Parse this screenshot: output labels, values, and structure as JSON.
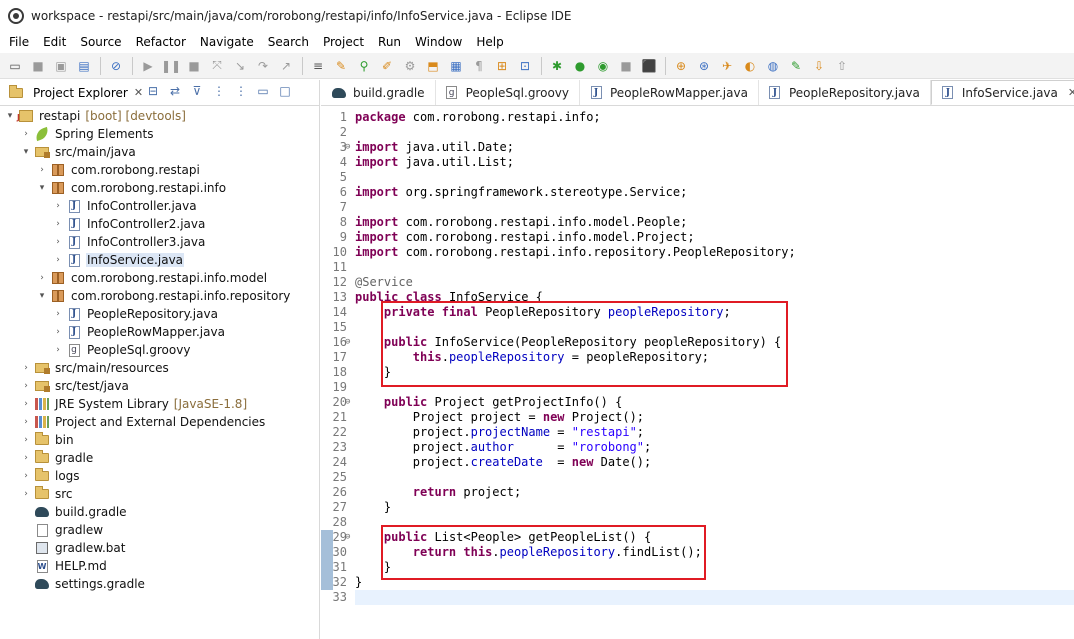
{
  "window": {
    "title": "workspace - restapi/src/main/java/com/rorobong/restapi/info/InfoService.java - Eclipse IDE"
  },
  "menu": [
    "File",
    "Edit",
    "Source",
    "Refactor",
    "Navigate",
    "Search",
    "Project",
    "Run",
    "Window",
    "Help"
  ],
  "explorer": {
    "tab_label": "Project Explorer",
    "tab_close": "✕",
    "tree": [
      {
        "label": "restapi",
        "decor": "[boot] [devtools]",
        "icon": "project-icon",
        "indent": 0,
        "twisty": "▾"
      },
      {
        "label": "Spring Elements",
        "decor": "",
        "icon": "spring-leaf-icon",
        "indent": 1,
        "twisty": "›"
      },
      {
        "label": "src/main/java",
        "decor": "",
        "icon": "source-folder-icon",
        "indent": 1,
        "twisty": "▾"
      },
      {
        "label": "com.rorobong.restapi",
        "decor": "",
        "icon": "package-icon",
        "indent": 2,
        "twisty": "›"
      },
      {
        "label": "com.rorobong.restapi.info",
        "decor": "",
        "icon": "package-icon",
        "indent": 2,
        "twisty": "▾"
      },
      {
        "label": "InfoController.java",
        "decor": "",
        "icon": "java-file-icon",
        "indent": 3,
        "twisty": "›"
      },
      {
        "label": "InfoController2.java",
        "decor": "",
        "icon": "java-file-icon",
        "indent": 3,
        "twisty": "›"
      },
      {
        "label": "InfoController3.java",
        "decor": "",
        "icon": "java-file-icon",
        "indent": 3,
        "twisty": "›"
      },
      {
        "label": "InfoService.java",
        "decor": "",
        "icon": "java-file-icon",
        "indent": 3,
        "twisty": "›",
        "selected": true
      },
      {
        "label": "com.rorobong.restapi.info.model",
        "decor": "",
        "icon": "package-icon",
        "indent": 2,
        "twisty": "›"
      },
      {
        "label": "com.rorobong.restapi.info.repository",
        "decor": "",
        "icon": "package-icon",
        "indent": 2,
        "twisty": "▾"
      },
      {
        "label": "PeopleRepository.java",
        "decor": "",
        "icon": "java-file-icon",
        "indent": 3,
        "twisty": "›"
      },
      {
        "label": "PeopleRowMapper.java",
        "decor": "",
        "icon": "java-file-icon",
        "indent": 3,
        "twisty": "›"
      },
      {
        "label": "PeopleSql.groovy",
        "decor": "",
        "icon": "groovy-file-icon",
        "indent": 3,
        "twisty": "›"
      },
      {
        "label": "src/main/resources",
        "decor": "",
        "icon": "source-folder-icon",
        "indent": 1,
        "twisty": "›"
      },
      {
        "label": "src/test/java",
        "decor": "",
        "icon": "source-folder-icon",
        "indent": 1,
        "twisty": "›"
      },
      {
        "label": "JRE System Library",
        "decor": "[JavaSE-1.8]",
        "icon": "library-icon",
        "indent": 1,
        "twisty": "›"
      },
      {
        "label": "Project and External Dependencies",
        "decor": "",
        "icon": "library-icon",
        "indent": 1,
        "twisty": "›"
      },
      {
        "label": "bin",
        "decor": "",
        "icon": "folder-icon",
        "indent": 1,
        "twisty": "›"
      },
      {
        "label": "gradle",
        "decor": "",
        "icon": "folder-icon",
        "indent": 1,
        "twisty": "›"
      },
      {
        "label": "logs",
        "decor": "",
        "icon": "folder-icon",
        "indent": 1,
        "twisty": "›"
      },
      {
        "label": "src",
        "decor": "",
        "icon": "folder-icon",
        "indent": 1,
        "twisty": "›"
      },
      {
        "label": "build.gradle",
        "decor": "",
        "icon": "gradle-elephant-icon",
        "indent": 1,
        "twisty": ""
      },
      {
        "label": "gradlew",
        "decor": "",
        "icon": "file-icon",
        "indent": 1,
        "twisty": ""
      },
      {
        "label": "gradlew.bat",
        "decor": "",
        "icon": "batch-file-icon",
        "indent": 1,
        "twisty": ""
      },
      {
        "label": "HELP.md",
        "decor": "",
        "icon": "markdown-file-icon",
        "indent": 1,
        "twisty": ""
      },
      {
        "label": "settings.gradle",
        "decor": "",
        "icon": "gradle-elephant-icon",
        "indent": 1,
        "twisty": ""
      }
    ]
  },
  "editor": {
    "tabs": [
      {
        "label": "build.gradle",
        "icon": "gradle-elephant-icon",
        "active": false
      },
      {
        "label": "PeopleSql.groovy",
        "icon": "groovy-file-icon",
        "active": false
      },
      {
        "label": "PeopleRowMapper.java",
        "icon": "java-file-icon",
        "active": false
      },
      {
        "label": "PeopleRepository.java",
        "icon": "java-file-icon",
        "active": false
      },
      {
        "label": "InfoService.java",
        "icon": "java-file-icon",
        "active": true
      }
    ],
    "tab_close": "✕",
    "lines": [
      {
        "n": "1",
        "tokens": [
          [
            "kw",
            "package"
          ],
          [
            "plain",
            " com.rorobong.restapi.info;"
          ]
        ]
      },
      {
        "n": "2",
        "tokens": []
      },
      {
        "n": "3",
        "fold": "⊖",
        "tokens": [
          [
            "kw",
            "import"
          ],
          [
            "plain",
            " java.util.Date;"
          ]
        ]
      },
      {
        "n": "4",
        "tokens": [
          [
            "kw",
            "import"
          ],
          [
            "plain",
            " java.util.List;"
          ]
        ]
      },
      {
        "n": "5",
        "tokens": []
      },
      {
        "n": "6",
        "tokens": [
          [
            "kw",
            "import"
          ],
          [
            "plain",
            " org.springframework.stereotype.Service;"
          ]
        ]
      },
      {
        "n": "7",
        "tokens": []
      },
      {
        "n": "8",
        "tokens": [
          [
            "kw",
            "import"
          ],
          [
            "plain",
            " com.rorobong.restapi.info.model.People;"
          ]
        ]
      },
      {
        "n": "9",
        "tokens": [
          [
            "kw",
            "import"
          ],
          [
            "plain",
            " com.rorobong.restapi.info.model.Project;"
          ]
        ]
      },
      {
        "n": "10",
        "tokens": [
          [
            "kw",
            "import"
          ],
          [
            "plain",
            " com.rorobong.restapi.info.repository.PeopleRepository;"
          ]
        ]
      },
      {
        "n": "11",
        "tokens": []
      },
      {
        "n": "12",
        "tokens": [
          [
            "ann",
            "@Service"
          ]
        ]
      },
      {
        "n": "13",
        "tokens": [
          [
            "kw",
            "public"
          ],
          [
            "plain",
            " "
          ],
          [
            "kw",
            "class"
          ],
          [
            "plain",
            " InfoService {"
          ]
        ]
      },
      {
        "n": "14",
        "tokens": [
          [
            "plain",
            "    "
          ],
          [
            "kw",
            "private"
          ],
          [
            "plain",
            " "
          ],
          [
            "kw",
            "final"
          ],
          [
            "plain",
            " PeopleRepository "
          ],
          [
            "field",
            "peopleRepository"
          ],
          [
            "plain",
            ";"
          ]
        ]
      },
      {
        "n": "15",
        "tokens": []
      },
      {
        "n": "16",
        "fold": "⊖",
        "tokens": [
          [
            "plain",
            "    "
          ],
          [
            "kw",
            "public"
          ],
          [
            "plain",
            " InfoService(PeopleRepository "
          ],
          [
            "plain",
            "peopleRepository"
          ],
          [
            "plain",
            ") {"
          ]
        ]
      },
      {
        "n": "17",
        "tokens": [
          [
            "plain",
            "        "
          ],
          [
            "kw",
            "this"
          ],
          [
            "plain",
            "."
          ],
          [
            "field",
            "peopleRepository"
          ],
          [
            "plain",
            " = peopleRepository;"
          ]
        ]
      },
      {
        "n": "18",
        "tokens": [
          [
            "plain",
            "    }"
          ]
        ]
      },
      {
        "n": "19",
        "tokens": []
      },
      {
        "n": "20",
        "fold": "⊖",
        "tokens": [
          [
            "plain",
            "    "
          ],
          [
            "kw",
            "public"
          ],
          [
            "plain",
            " Project getProjectInfo() {"
          ]
        ]
      },
      {
        "n": "21",
        "tokens": [
          [
            "plain",
            "        Project "
          ],
          [
            "plain",
            "project"
          ],
          [
            "plain",
            " = "
          ],
          [
            "kw",
            "new"
          ],
          [
            "plain",
            " Project();"
          ]
        ]
      },
      {
        "n": "22",
        "tokens": [
          [
            "plain",
            "        project."
          ],
          [
            "field",
            "projectName"
          ],
          [
            "plain",
            " = "
          ],
          [
            "str",
            "\"restapi\""
          ],
          [
            "plain",
            ";"
          ]
        ]
      },
      {
        "n": "23",
        "tokens": [
          [
            "plain",
            "        project."
          ],
          [
            "field",
            "author"
          ],
          [
            "plain",
            "      = "
          ],
          [
            "str",
            "\"rorobong\""
          ],
          [
            "plain",
            ";"
          ]
        ]
      },
      {
        "n": "24",
        "tokens": [
          [
            "plain",
            "        project."
          ],
          [
            "field",
            "createDate"
          ],
          [
            "plain",
            "  = "
          ],
          [
            "kw",
            "new"
          ],
          [
            "plain",
            " Date();"
          ]
        ]
      },
      {
        "n": "25",
        "tokens": []
      },
      {
        "n": "26",
        "tokens": [
          [
            "plain",
            "        "
          ],
          [
            "kw",
            "return"
          ],
          [
            "plain",
            " project;"
          ]
        ]
      },
      {
        "n": "27",
        "tokens": [
          [
            "plain",
            "    }"
          ]
        ]
      },
      {
        "n": "28",
        "tokens": []
      },
      {
        "n": "29",
        "fold": "⊖",
        "tokens": [
          [
            "plain",
            "    "
          ],
          [
            "kw",
            "public"
          ],
          [
            "plain",
            " List<People> getPeopleList() {"
          ]
        ]
      },
      {
        "n": "30",
        "tokens": [
          [
            "plain",
            "        "
          ],
          [
            "kw",
            "return"
          ],
          [
            "plain",
            " "
          ],
          [
            "kw",
            "this"
          ],
          [
            "plain",
            "."
          ],
          [
            "field",
            "peopleRepository"
          ],
          [
            "plain",
            ".findList();"
          ]
        ]
      },
      {
        "n": "31",
        "tokens": [
          [
            "plain",
            "    }"
          ]
        ]
      },
      {
        "n": "32",
        "tokens": [
          [
            "plain",
            "}"
          ]
        ]
      },
      {
        "n": "33",
        "tokens": [],
        "current": true
      }
    ]
  }
}
